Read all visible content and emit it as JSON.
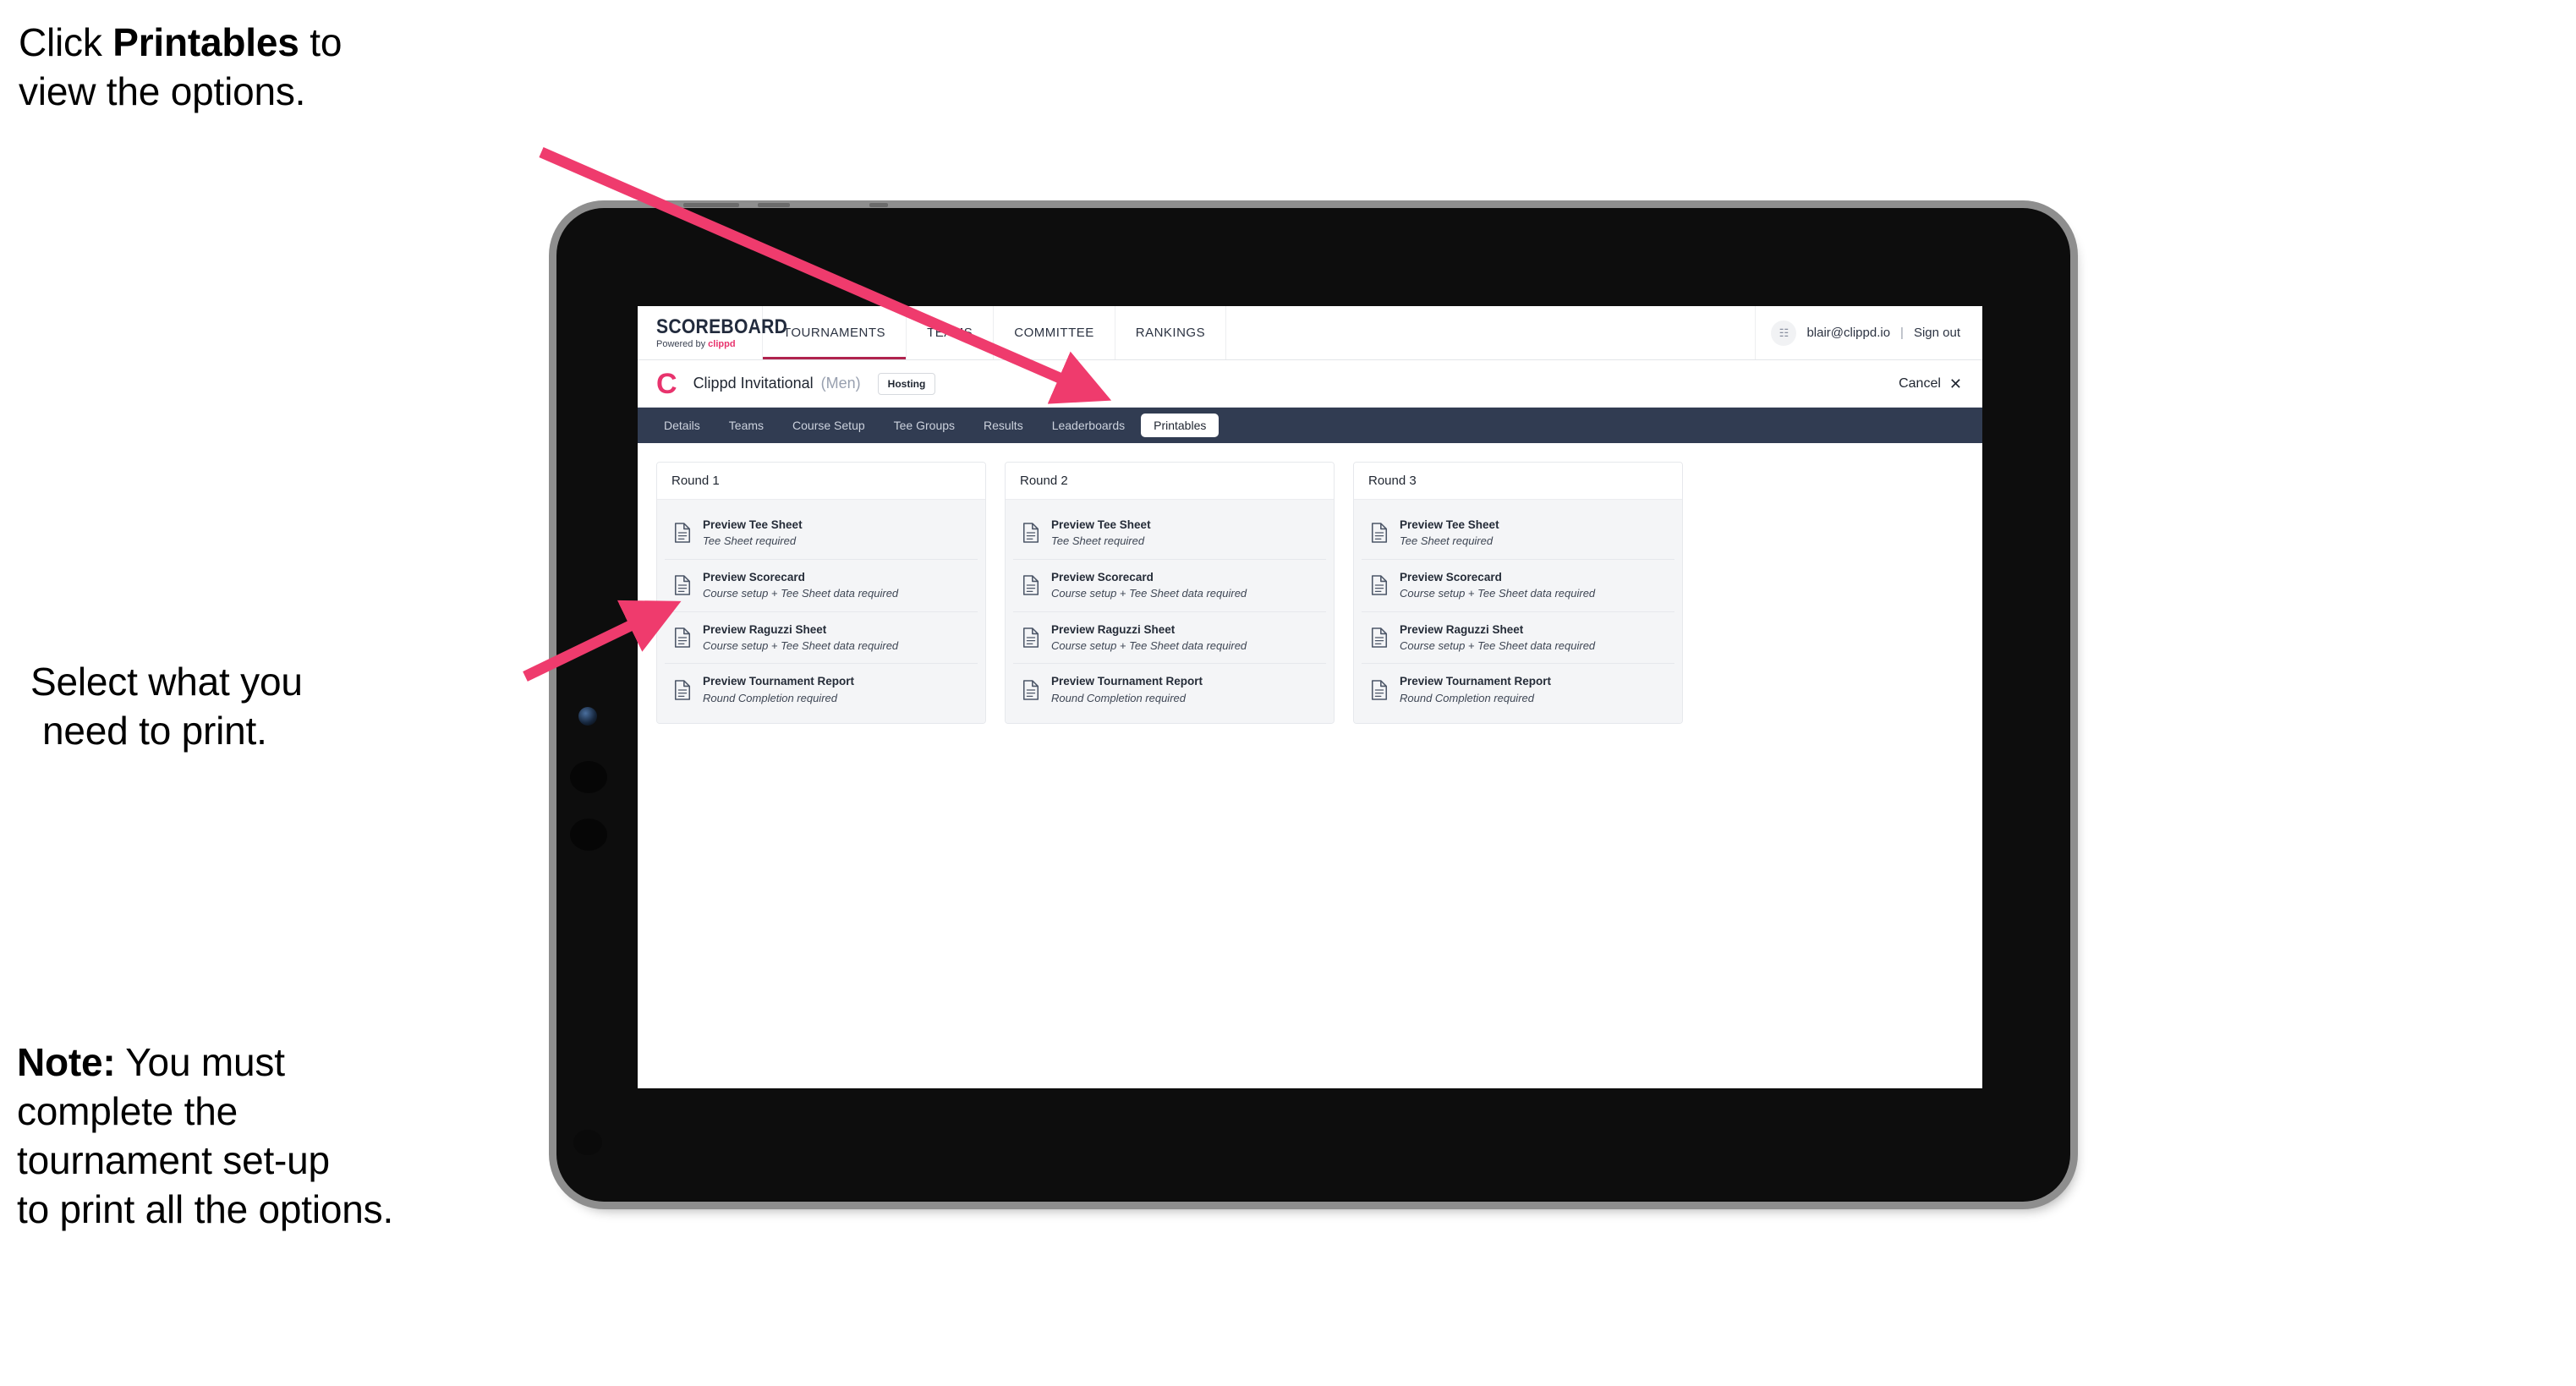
{
  "instructions": {
    "callout_1": {
      "name": "click-printables-callout",
      "line1_pre": "Click ",
      "line1_bold": "Printables",
      "line1_post": " to",
      "line2": "view the options."
    },
    "callout_2": {
      "name": "select-what-to-print-callout",
      "line1": "Select what you",
      "line2": "need to print."
    },
    "callout_3": {
      "name": "note-callout",
      "label_bold": "Note:",
      "line1_post": " You must",
      "line2": "complete the",
      "line3": "tournament set-up",
      "line4": "to print all the options."
    }
  },
  "app": {
    "brand": {
      "word": "SCOREBOARD",
      "sub_prefix": "Powered by ",
      "sub_brand": "clippd"
    },
    "topnav": [
      {
        "label": "TOURNAMENTS",
        "active": true
      },
      {
        "label": "TEAMS",
        "active": false
      },
      {
        "label": "COMMITTEE",
        "active": false
      },
      {
        "label": "RANKINGS",
        "active": false
      }
    ],
    "user": {
      "avatar_glyph": "☷",
      "email": "blair@clippd.io",
      "separator": "|",
      "signout": "Sign out"
    },
    "tournament": {
      "logo_letter": "C",
      "name": "Clippd Invitational",
      "gender": "(Men)",
      "badge": "Hosting",
      "cancel_label": "Cancel",
      "cancel_x": "✕"
    },
    "tabs": [
      {
        "label": "Details",
        "active": false
      },
      {
        "label": "Teams",
        "active": false
      },
      {
        "label": "Course Setup",
        "active": false
      },
      {
        "label": "Tee Groups",
        "active": false
      },
      {
        "label": "Results",
        "active": false
      },
      {
        "label": "Leaderboards",
        "active": false
      },
      {
        "label": "Printables",
        "active": true
      }
    ],
    "rounds": [
      {
        "title": "Round 1",
        "items": [
          {
            "title": "Preview Tee Sheet",
            "sub": "Tee Sheet required"
          },
          {
            "title": "Preview Scorecard",
            "sub": "Course setup + Tee Sheet data required"
          },
          {
            "title": "Preview Raguzzi Sheet",
            "sub": "Course setup + Tee Sheet data required"
          },
          {
            "title": "Preview Tournament Report",
            "sub": "Round Completion required"
          }
        ]
      },
      {
        "title": "Round 2",
        "items": [
          {
            "title": "Preview Tee Sheet",
            "sub": "Tee Sheet required"
          },
          {
            "title": "Preview Scorecard",
            "sub": "Course setup + Tee Sheet data required"
          },
          {
            "title": "Preview Raguzzi Sheet",
            "sub": "Course setup + Tee Sheet data required"
          },
          {
            "title": "Preview Tournament Report",
            "sub": "Round Completion required"
          }
        ]
      },
      {
        "title": "Round 3",
        "items": [
          {
            "title": "Preview Tee Sheet",
            "sub": "Tee Sheet required"
          },
          {
            "title": "Preview Scorecard",
            "sub": "Course setup + Tee Sheet data required"
          },
          {
            "title": "Preview Raguzzi Sheet",
            "sub": "Course setup + Tee Sheet data required"
          },
          {
            "title": "Preview Tournament Report",
            "sub": "Round Completion required"
          }
        ]
      }
    ]
  },
  "colors": {
    "accent_pink": "#e8336d",
    "arrow_pink": "#ef3b6d",
    "tabstrip_navy": "#313c52",
    "nav_underline": "#b0234e",
    "card_bg": "#f4f5f7"
  }
}
